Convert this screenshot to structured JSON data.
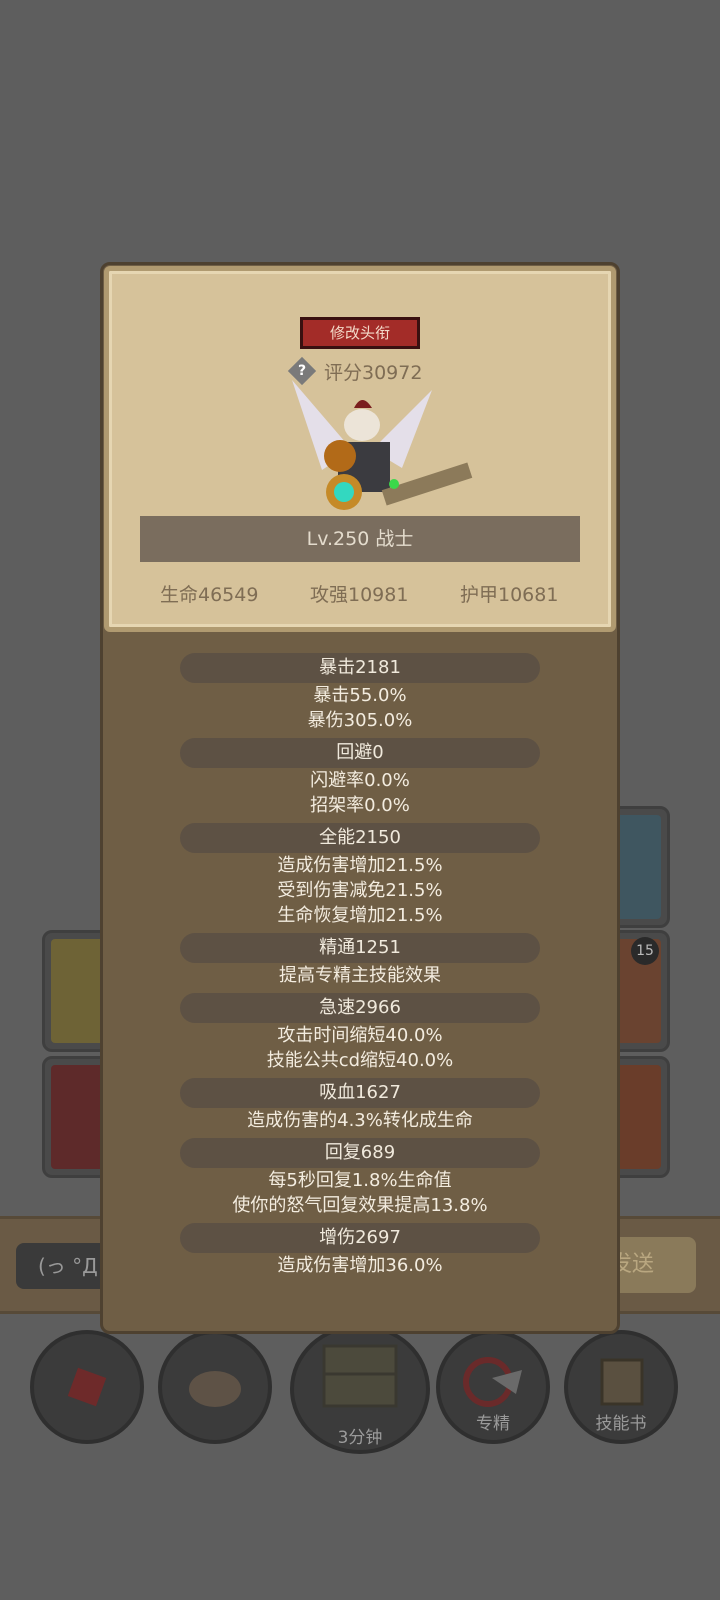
{
  "background": {
    "chat_placeholder": "(っ °Д °",
    "send_label": "发送",
    "card_badge": "15",
    "bottom_buttons": [
      {
        "icon": "potion-icon",
        "label": ""
      },
      {
        "icon": "bread-icon",
        "label": ""
      },
      {
        "icon": "chest-icon",
        "label": "3分钟"
      },
      {
        "icon": "mastery-icon",
        "label": "专精"
      },
      {
        "icon": "skill-book-icon",
        "label": "技能书"
      }
    ]
  },
  "profile": {
    "edit_title_label": "修改头衔",
    "score": "评分30972",
    "level_class": "Lv.250 战士",
    "stats": {
      "life": "生命46549",
      "attack": "攻强10981",
      "armor": "护甲10681"
    }
  },
  "details": [
    {
      "header": "暴击2181",
      "lines": [
        "暴击55.0%",
        "暴伤305.0%"
      ]
    },
    {
      "header": "回避0",
      "lines": [
        "闪避率0.0%",
        "招架率0.0%"
      ]
    },
    {
      "header": "全能2150",
      "lines": [
        "造成伤害增加21.5%",
        "受到伤害减免21.5%",
        "生命恢复增加21.5%"
      ]
    },
    {
      "header": "精通1251",
      "lines": [
        "提高专精主技能效果"
      ]
    },
    {
      "header": "急速2966",
      "lines": [
        "攻击时间缩短40.0%",
        "技能公共cd缩短40.0%"
      ]
    },
    {
      "header": "吸血1627",
      "lines": [
        "造成伤害的4.3%转化成生命"
      ]
    },
    {
      "header": "回复689",
      "lines": [
        "每5秒回复1.8%生命值",
        "使你的怒气回复效果提高13.8%"
      ]
    },
    {
      "header": "增伤2697",
      "lines": [
        "造成伤害增加36.0%"
      ]
    }
  ],
  "colors": {
    "overlay": "#5e5e5e",
    "panel": "#6f5e45",
    "parchment": "#d6c29a",
    "title_button": "#a32c28"
  }
}
